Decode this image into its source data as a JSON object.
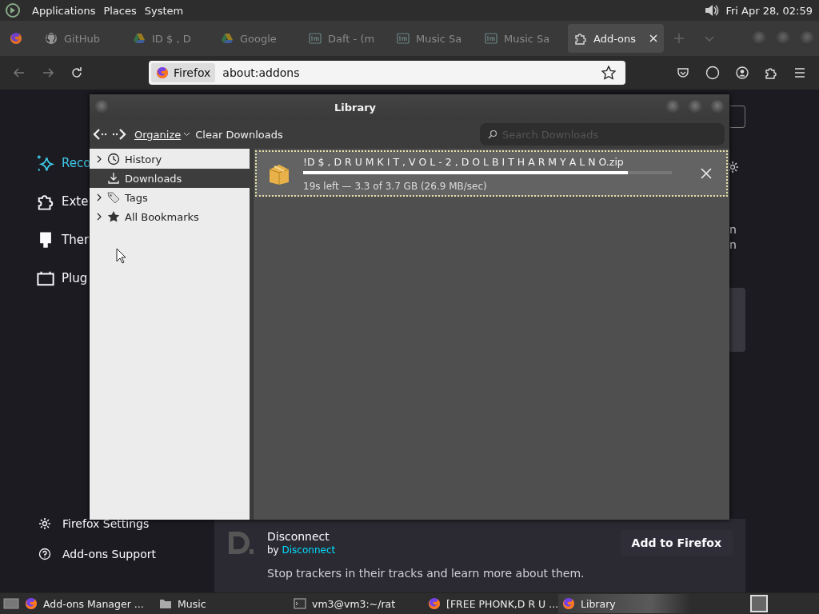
{
  "top_panel": {
    "menus": [
      "Applications",
      "Places",
      "System"
    ],
    "clock": "Fri Apr 28, 02:59"
  },
  "tabs": [
    {
      "kind": "fox",
      "selected": false
    },
    {
      "label": "GitHub",
      "kind": "cat",
      "selected": false
    },
    {
      "label": "ID $ , D",
      "kind": "triangle",
      "selected": false
    },
    {
      "label": "Google",
      "kind": "triangle",
      "selected": false
    },
    {
      "label": "Daft - (m",
      "kind": "lm",
      "selected": false
    },
    {
      "label": "Music Sa",
      "kind": "lm",
      "selected": false
    },
    {
      "label": "Music Sa",
      "kind": "lm",
      "selected": false
    },
    {
      "label": "Add-ons",
      "kind": "puzzle",
      "selected": true
    }
  ],
  "address_bar": {
    "identity": "Firefox",
    "url": "about:addons"
  },
  "addons_page": {
    "categories": [
      {
        "label": "Reco",
        "kind": "sparkle",
        "selected": true
      },
      {
        "label": "Exte",
        "kind": "puzzle",
        "selected": false
      },
      {
        "label": "Ther",
        "kind": "brush",
        "selected": false
      },
      {
        "label": "Plug",
        "kind": "plugin",
        "selected": false
      }
    ],
    "card_fragments": [
      "n",
      "n"
    ],
    "footer_links": [
      {
        "label": "Firefox Settings",
        "kind": "gear"
      },
      {
        "label": "Add-ons Support",
        "kind": "help"
      }
    ],
    "addon": {
      "name": "Disconnect",
      "by": "by",
      "author": "Disconnect",
      "description": "Stop trackers in their tracks and learn more about them.",
      "button": "Add to Firefox"
    }
  },
  "library": {
    "title": "Library",
    "organize": "Organize",
    "clear": "Clear Downloads",
    "search_placeholder": "Search Downloads",
    "places": [
      {
        "label": "History",
        "kind": "clock",
        "expandable": true,
        "selected": false
      },
      {
        "label": "Downloads",
        "kind": "download",
        "expandable": false,
        "selected": true
      },
      {
        "label": "Tags",
        "kind": "tag",
        "expandable": true,
        "selected": false
      },
      {
        "label": "All Bookmarks",
        "kind": "star",
        "expandable": true,
        "selected": false
      }
    ],
    "downloads": [
      {
        "name": "!D $ , D R U M K I T , V O L - 2 , D O L B I T H A R M Y A L N O.zip",
        "level": 0.88,
        "status": "19s left — 3.3 of 3.7 GB (26.9 MB/sec)",
        "selected": true
      }
    ]
  },
  "taskbar": {
    "items": [
      {
        "label": "Add-ons Manager ...",
        "kind": "fox",
        "selected": false
      },
      {
        "label": "Music",
        "kind": "folder",
        "selected": false
      },
      {
        "label": "vm3@vm3:~/rat",
        "kind": "terminal",
        "selected": false
      },
      {
        "label": "[FREE PHONK,D R U ...",
        "kind": "fox",
        "selected": false
      },
      {
        "label": "Library",
        "kind": "fox",
        "selected": true
      }
    ]
  }
}
